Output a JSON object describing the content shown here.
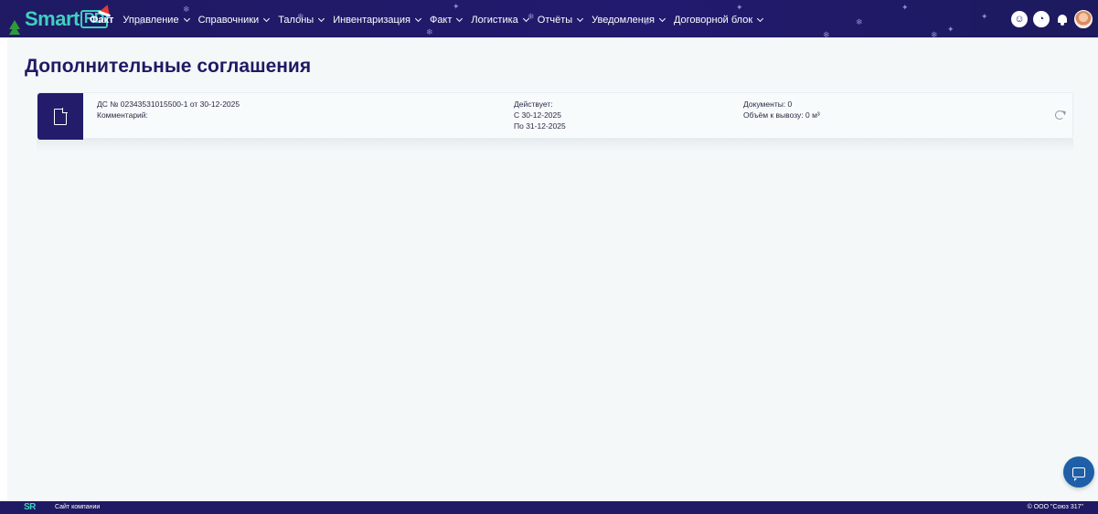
{
  "brand": {
    "name_a": "Smart",
    "name_b": "RD"
  },
  "nav": {
    "items": [
      {
        "label": "Факт",
        "active": true,
        "chevron": false
      },
      {
        "label": "Управление",
        "chevron": true
      },
      {
        "label": "Справочники",
        "chevron": true
      },
      {
        "label": "Талоны",
        "chevron": true
      },
      {
        "label": "Инвентаризация",
        "chevron": true
      },
      {
        "label": "Факт",
        "chevron": true
      },
      {
        "label": "Логистика",
        "chevron": true
      },
      {
        "label": "Отчёты",
        "chevron": true
      },
      {
        "label": "Уведомления",
        "chevron": true
      },
      {
        "label": "Договорной блок",
        "chevron": true
      }
    ],
    "right_icons": [
      "support-icon",
      "timer-icon",
      "bell-icon",
      "avatar"
    ]
  },
  "page": {
    "title": "Дополнительные соглашения"
  },
  "card": {
    "doc_line": "ДС № 02343531015500-1 от 30-12-2025",
    "comment": "Комментарий:",
    "valid_label": "Действует:",
    "valid_from": "С 30-12-2025",
    "valid_to": "По 31-12-2025",
    "documents": "Документы: 0",
    "volume": "Объём к вывозу: 0 м³"
  },
  "footer": {
    "logo": "SR",
    "link": "Сайт компании",
    "copyright": "© ООО \"Союз 317\""
  },
  "colors": {
    "navbar": "#1f1a63",
    "accent": "#3fd0c0",
    "doc_tile": "#221c6b",
    "chat_button": "#1e5fa8",
    "page_bg": "#f4f8f9"
  }
}
